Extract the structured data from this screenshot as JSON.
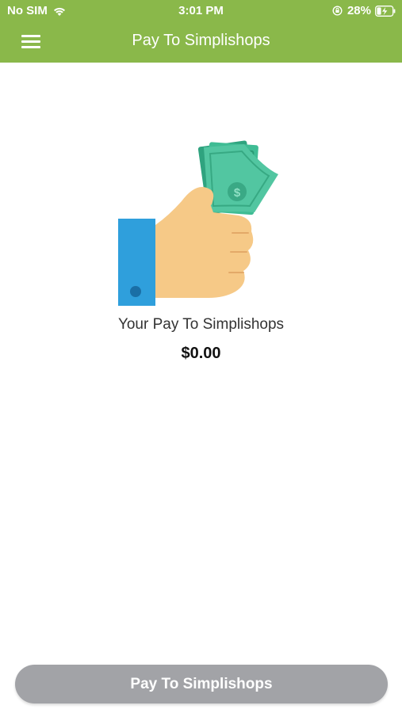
{
  "status_bar": {
    "carrier": "No SIM",
    "time": "3:01 PM",
    "battery_percent": "28%",
    "wifi_icon": "wifi-icon",
    "orientation_lock_icon": "orientation-lock-icon",
    "battery_icon": "battery-charging-icon"
  },
  "header": {
    "title": "Pay To Simplishops",
    "menu_icon": "hamburger-menu-icon",
    "background_color": "#8ab84a"
  },
  "main": {
    "illustration_icon": "hand-holding-money-icon",
    "label": "Your Pay To Simplishops",
    "amount": "$0.00"
  },
  "footer": {
    "button_label": "Pay To Simplishops",
    "button_color": "#a2a3a7"
  }
}
